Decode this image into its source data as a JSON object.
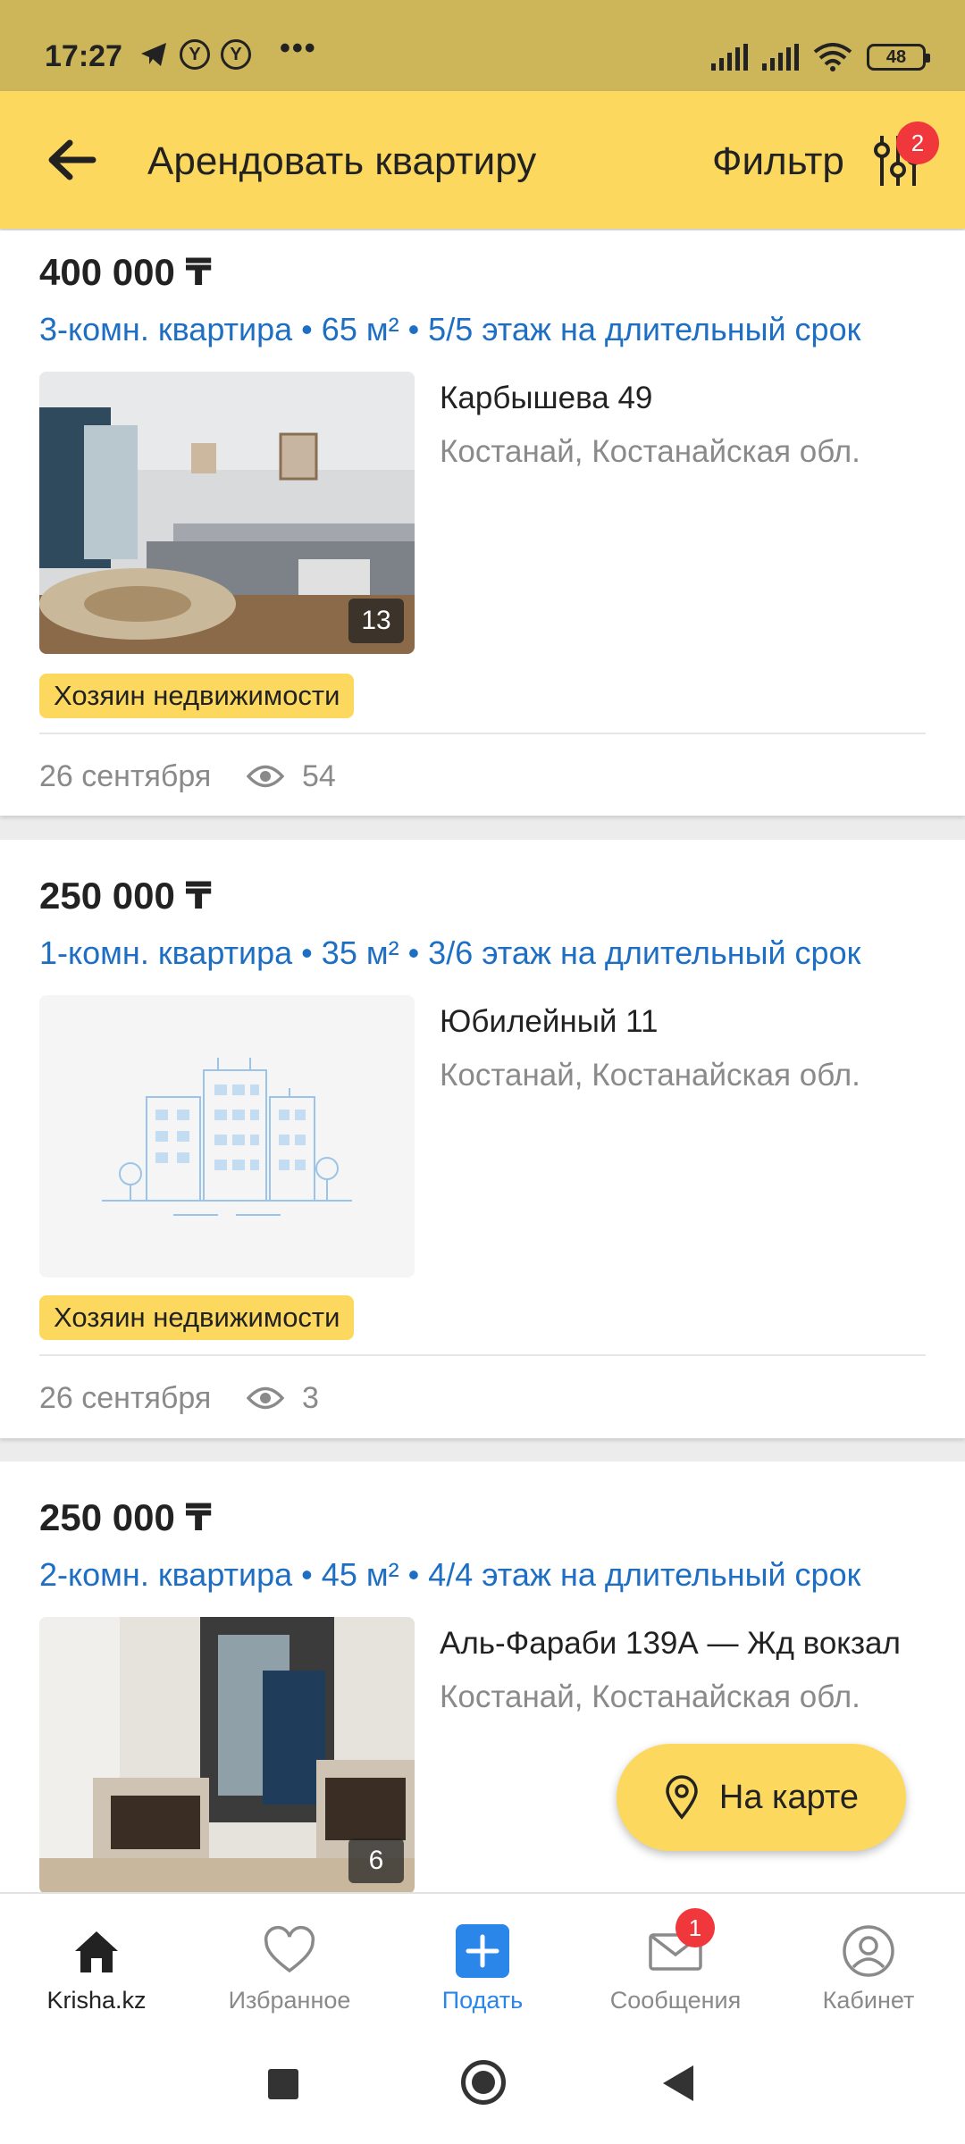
{
  "status_bar": {
    "time": "17:27",
    "circle_icon_letter": "Y",
    "battery": "48"
  },
  "header": {
    "title": "Арендовать квартиру",
    "filter_label": "Фильтр",
    "filter_badge": "2"
  },
  "listings": [
    {
      "price": "400 000 ₸",
      "description": "3-комн. квартира • 65 м² • 5/5 этаж на длительный срок",
      "street": "Карбышева 49",
      "city": "Костанай, Костанайская обл.",
      "photo_count": "13",
      "photo_type": "living-room-photo",
      "owner_badge": "Хозяин недвижимости",
      "date": "26 сентября",
      "views": "54"
    },
    {
      "price": "250 000 ₸",
      "description": "1-комн. квартира • 35 м² • 3/6 этаж на длительный срок",
      "street": "Юбилейный 11",
      "city": "Костанай, Костанайская обл.",
      "photo_type": "building-placeholder",
      "owner_badge": "Хозяин недвижимости",
      "date": "26 сентября",
      "views": "3"
    },
    {
      "price": "250 000 ₸",
      "description": "2-комн. квартира • 45 м² • 4/4 этаж на длительный срок",
      "street": "Аль-Фараби 139А — Жд вокзал",
      "city": "Костанай, Костанайская обл.",
      "photo_count": "6",
      "photo_type": "room-with-armchairs-photo"
    }
  ],
  "map_button": {
    "label": "На карте"
  },
  "bottom_nav": [
    {
      "label": "Krisha.kz",
      "icon": "home-icon",
      "active": true
    },
    {
      "label": "Избранное",
      "icon": "heart-icon"
    },
    {
      "label": "Подать",
      "icon": "plus-icon"
    },
    {
      "label": "Сообщения",
      "icon": "envelope-icon",
      "badge": "1"
    },
    {
      "label": "Кабинет",
      "icon": "profile-icon"
    }
  ],
  "colors": {
    "accent": "#fcd95e",
    "link": "#1e6fc4",
    "badge": "#f0383c",
    "nav_blue": "#2a86e8"
  }
}
